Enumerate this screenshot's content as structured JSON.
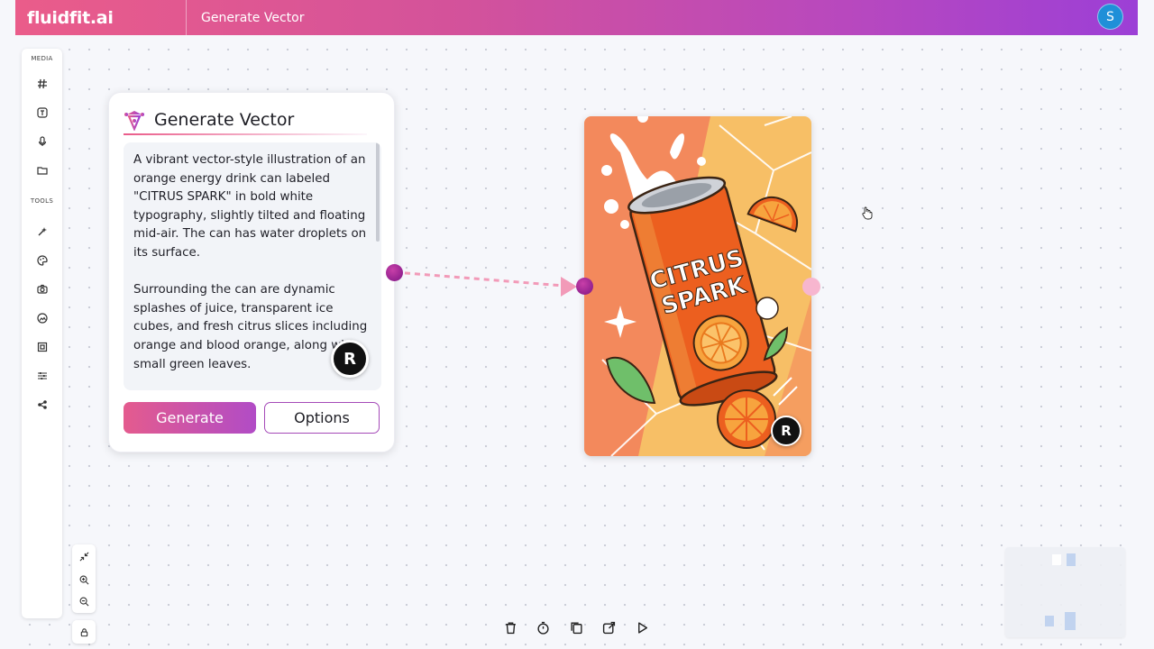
{
  "header": {
    "brand": "fluidfit.ai",
    "title": "Generate Vector",
    "avatar_initial": "S"
  },
  "toolbar": {
    "media_label": "MEDIA",
    "tools_label": "TOOLS",
    "media_items": [
      "hash-icon",
      "text-box-icon",
      "microphone-icon",
      "folder-icon"
    ],
    "tool_items": [
      "sparkle-wand-icon",
      "palette-icon",
      "camera-icon",
      "image-edit-icon",
      "frame-icon",
      "sliders-icon",
      "share-nodes-icon"
    ]
  },
  "card": {
    "title": "Generate Vector",
    "prompt": "A vibrant vector-style illustration of an orange energy drink can labeled \"CITRUS SPARK\" in bold white typography, slightly tilted and floating mid-air. The can has water droplets on its surface.\n\nSurrounding the can are dynamic splashes of juice, transparent ice cubes, and fresh citrus slices including orange and blood orange, along with small green leaves.",
    "generate_label": "Generate",
    "options_label": "Options",
    "badge": "R"
  },
  "image_node": {
    "can_text_line1": "CITRUS",
    "can_text_line2": "SPARK",
    "badge": "R"
  },
  "colors": {
    "accent_pink": "#e45b8e",
    "accent_purple": "#b14cc6",
    "header_start": "#ea5c8a",
    "header_end": "#9c3fd6",
    "avatar": "#1f8fd8",
    "connector_dot": "#8b1f8f",
    "connector_line": "#f29ab8"
  },
  "bottom_actions": [
    "trash-icon",
    "timer-icon",
    "copy-icon",
    "share-icon",
    "play-icon"
  ]
}
